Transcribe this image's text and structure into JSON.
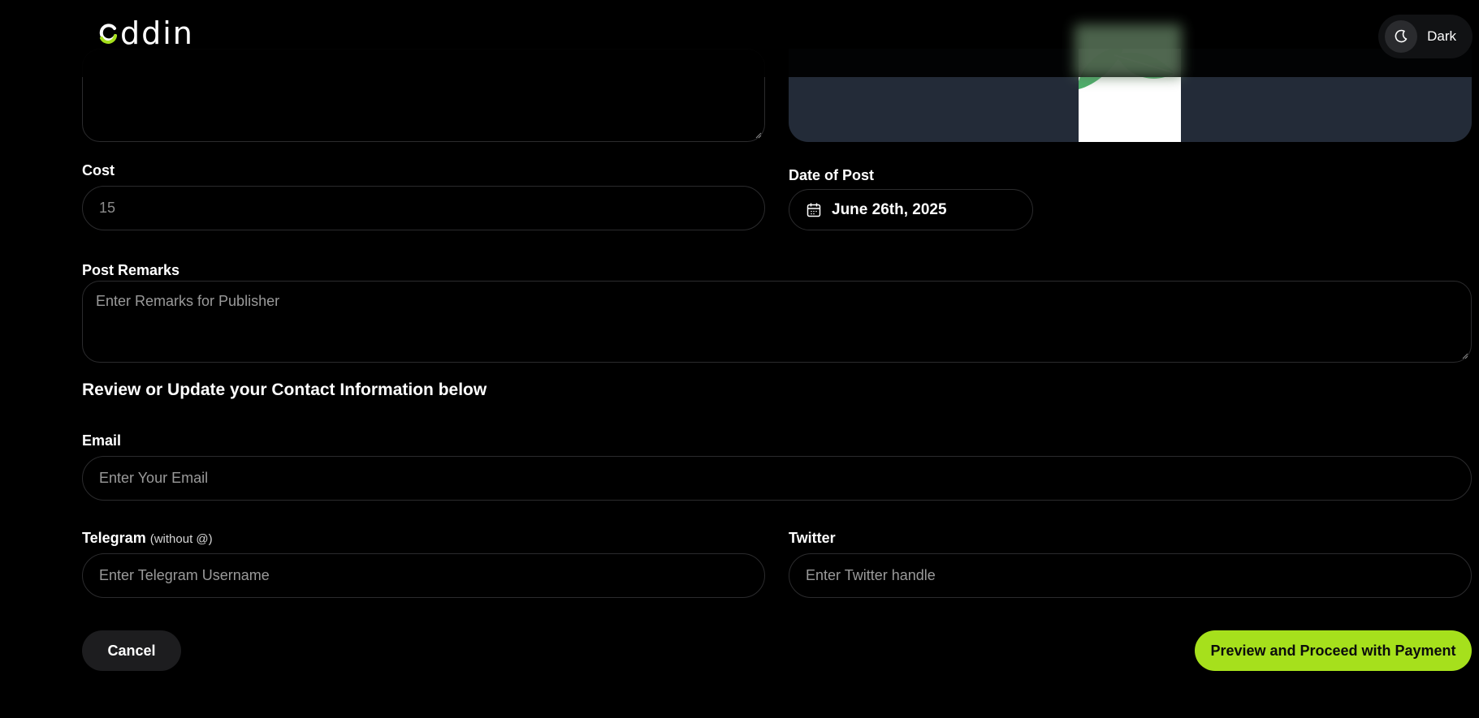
{
  "header": {
    "logo_text": "ddin",
    "theme_label": "Dark",
    "accent_color": "#a6e01c"
  },
  "form": {
    "cost": {
      "label": "Cost",
      "value": "15"
    },
    "date_of_post": {
      "label": "Date of Post",
      "value": "June 26th, 2025",
      "icon": "calendar-icon"
    },
    "post_remarks": {
      "label": "Post Remarks",
      "placeholder": "Enter Remarks for Publisher"
    }
  },
  "contact": {
    "heading": "Review or Update your Contact Information below",
    "email": {
      "label": "Email",
      "placeholder": "Enter Your Email"
    },
    "telegram": {
      "label": "Telegram",
      "hint": "(without @)",
      "placeholder": "Enter Telegram Username"
    },
    "twitter": {
      "label": "Twitter",
      "placeholder": "Enter Twitter handle"
    }
  },
  "actions": {
    "cancel_label": "Cancel",
    "proceed_label": "Preview and Proceed with Payment"
  }
}
